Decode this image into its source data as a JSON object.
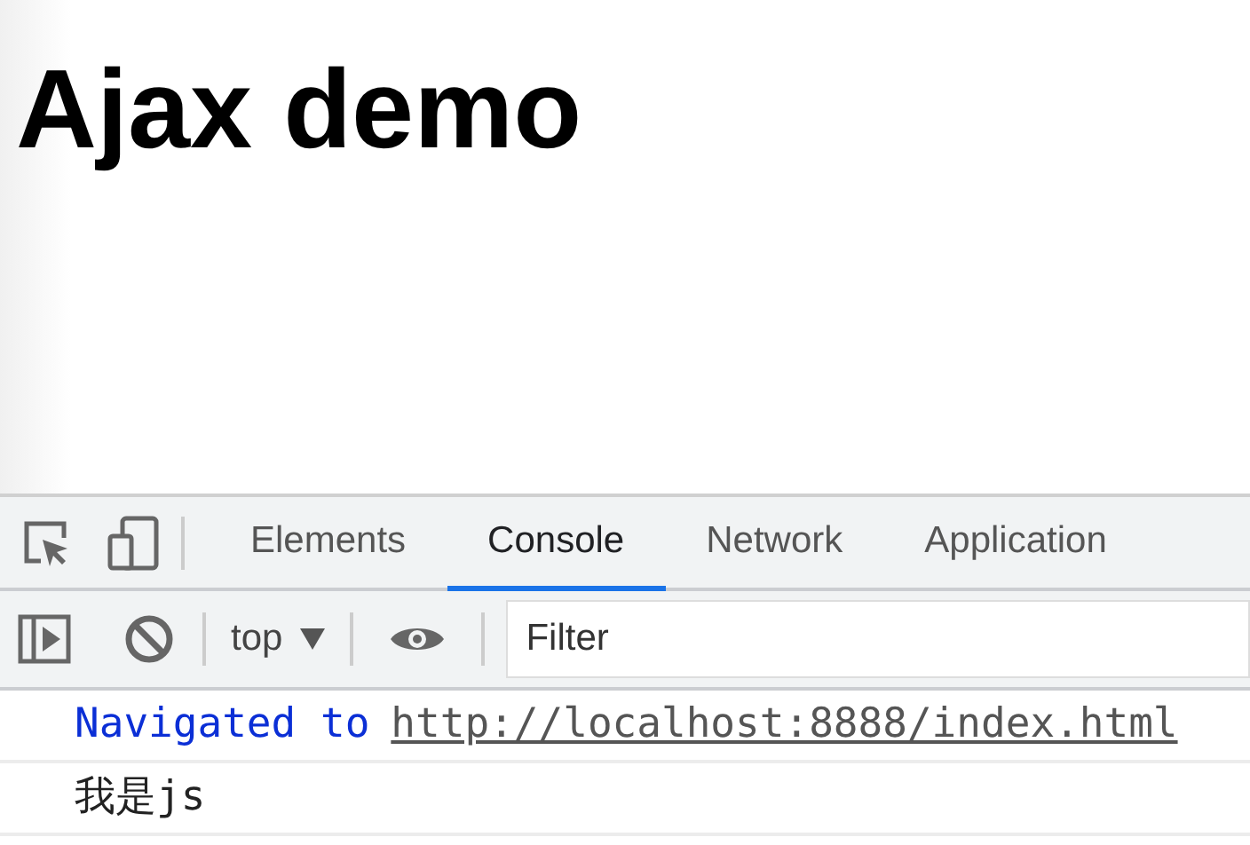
{
  "page": {
    "heading": "Ajax demo"
  },
  "devtools": {
    "tabs": [
      {
        "label": "Elements",
        "selected": false
      },
      {
        "label": "Console",
        "selected": true
      },
      {
        "label": "Network",
        "selected": false
      },
      {
        "label": "Application",
        "selected": false
      }
    ],
    "toolbar": {
      "context": "top",
      "filter": {
        "placeholder": "Filter"
      }
    },
    "console": [
      {
        "kind": "navigation",
        "text": "Navigated to",
        "url": "http://localhost:8888/index.html"
      },
      {
        "kind": "log",
        "text": "我是js"
      }
    ]
  }
}
